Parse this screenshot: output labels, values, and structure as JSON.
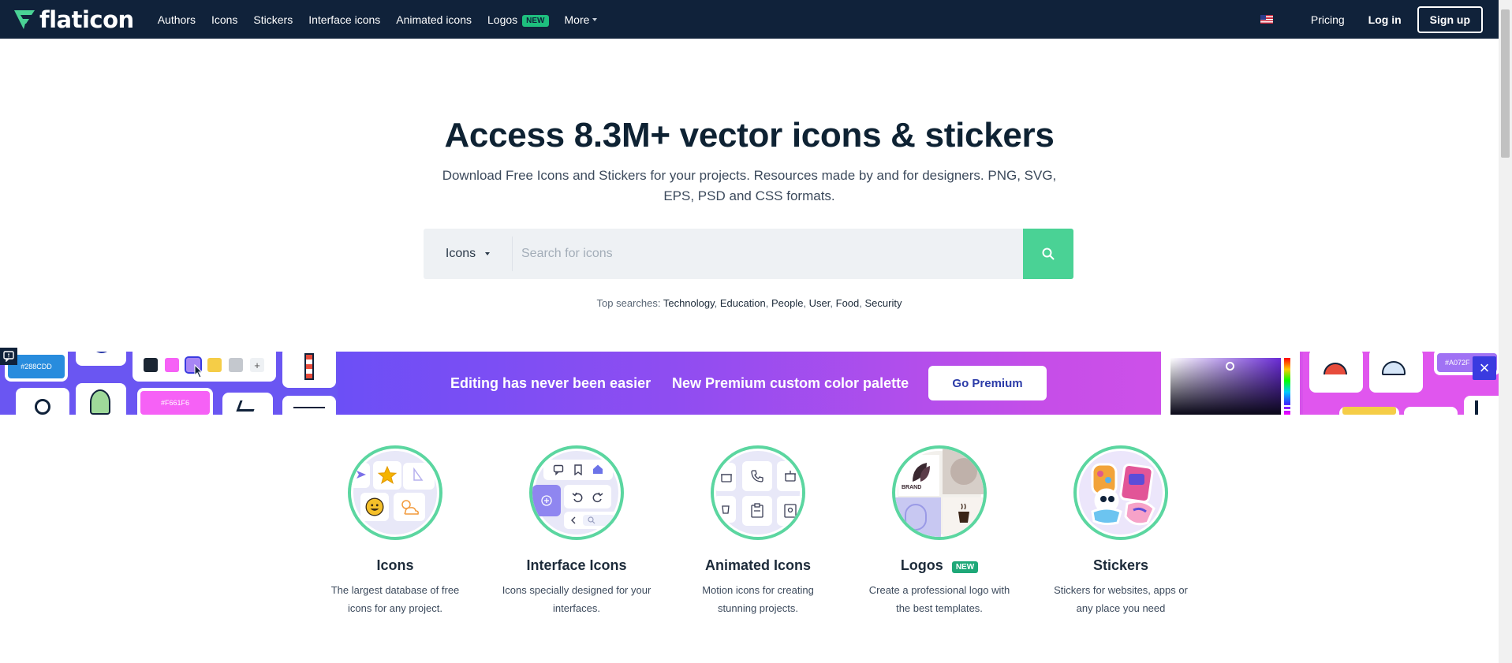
{
  "nav": {
    "brand": "flaticon",
    "links": [
      {
        "label": "Authors"
      },
      {
        "label": "Icons"
      },
      {
        "label": "Stickers"
      },
      {
        "label": "Interface icons"
      },
      {
        "label": "Animated icons"
      },
      {
        "label": "Logos",
        "badge": "NEW"
      },
      {
        "label": "More"
      }
    ],
    "pricing": "Pricing",
    "login": "Log in",
    "signup": "Sign up"
  },
  "hero": {
    "title": "Access 8.3M+ vector icons & stickers",
    "subtitle": "Download Free Icons and Stickers for your projects. Resources made by and for designers. PNG, SVG, EPS, PSD and CSS formats."
  },
  "search": {
    "type_label": "Icons",
    "placeholder": "Search for icons"
  },
  "top_searches": {
    "label": "Top searches:",
    "terms": [
      "Technology",
      "Education",
      "People",
      "User",
      "Food",
      "Security"
    ]
  },
  "banner": {
    "text1": "Editing has never been easier",
    "text2": "New Premium custom color palette",
    "cta": "Go Premium",
    "swatch_left": "#288CDD",
    "swatch_mid": "#F661F6",
    "swatch_right": "#A072F",
    "close": "×",
    "plus": "+"
  },
  "categories": [
    {
      "title": "Icons",
      "desc": "The largest database of free icons for any project."
    },
    {
      "title": "Interface Icons",
      "desc": "Icons specially designed for your interfaces."
    },
    {
      "title": "Animated Icons",
      "desc": "Motion icons for creating stunning projects."
    },
    {
      "title": "Logos",
      "badge": "NEW",
      "desc": "Create a professional logo with the best templates."
    },
    {
      "title": "Stickers",
      "desc": "Stickers for websites, apps or any place you need"
    }
  ],
  "colors": {
    "nav_bg": "#10223a",
    "accent_green": "#4ad295",
    "banner_purple": "#6b4ff6",
    "banner_pink": "#e257ec"
  }
}
